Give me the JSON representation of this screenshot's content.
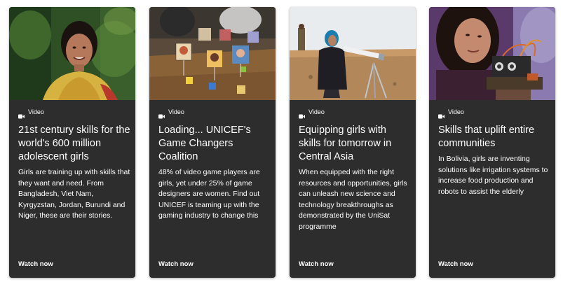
{
  "cards": [
    {
      "tag": "Video",
      "icon": "video-icon",
      "title": "21st century skills for the world's 600 million adolescent girls",
      "description": "Girls are training up with skills that they want and need. From Bangladesh, Viet Nam, Kyrgyzstan, Jordan, Burundi and Niger, these are their stories.",
      "cta": "Watch now"
    },
    {
      "tag": "Video",
      "icon": "video-icon",
      "title": "Loading... UNICEF's Game Changers Coalition",
      "description": "48% of video game players are girls, yet under 25% of game designers are women.  Find out UNICEF is teaming up with the gaming industry to change this",
      "cta": "Watch now"
    },
    {
      "tag": "Video",
      "icon": "video-icon",
      "title": "Equipping girls with skills for tomorrow in Central Asia",
      "description": "When equipped with the right resources and opportunities, girls can unleash new science and technology breakthroughs as demonstrated by the UniSat programme",
      "cta": "Watch now"
    },
    {
      "tag": "Video",
      "icon": "video-icon",
      "title": "Skills that uplift entire communities",
      "description": "In Bolivia, girls are inventing solutions like irrigation systems to increase food production and robots to assist the elderly",
      "cta": "Watch now"
    }
  ],
  "colors": {
    "card_background": "#2d2d2d",
    "text": "#ffffff",
    "page_background": "#ffffff"
  }
}
